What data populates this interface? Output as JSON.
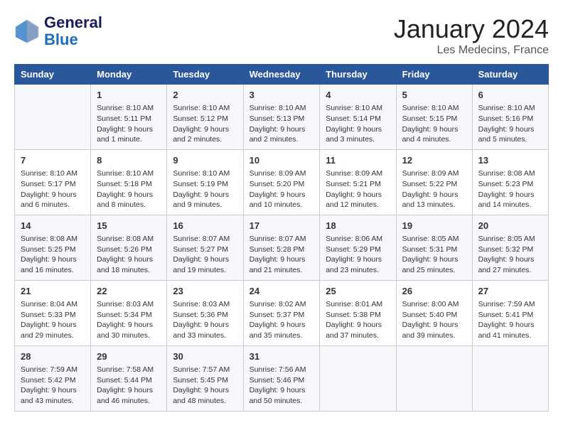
{
  "header": {
    "logo_line1": "General",
    "logo_line2": "Blue",
    "calendar_title": "January 2024",
    "calendar_subtitle": "Les Medecins, France"
  },
  "weekdays": [
    "Sunday",
    "Monday",
    "Tuesday",
    "Wednesday",
    "Thursday",
    "Friday",
    "Saturday"
  ],
  "weeks": [
    [
      {
        "day": "",
        "info": ""
      },
      {
        "day": "1",
        "info": "Sunrise: 8:10 AM\nSunset: 5:11 PM\nDaylight: 9 hours\nand 1 minute."
      },
      {
        "day": "2",
        "info": "Sunrise: 8:10 AM\nSunset: 5:12 PM\nDaylight: 9 hours\nand 2 minutes."
      },
      {
        "day": "3",
        "info": "Sunrise: 8:10 AM\nSunset: 5:13 PM\nDaylight: 9 hours\nand 2 minutes."
      },
      {
        "day": "4",
        "info": "Sunrise: 8:10 AM\nSunset: 5:14 PM\nDaylight: 9 hours\nand 3 minutes."
      },
      {
        "day": "5",
        "info": "Sunrise: 8:10 AM\nSunset: 5:15 PM\nDaylight: 9 hours\nand 4 minutes."
      },
      {
        "day": "6",
        "info": "Sunrise: 8:10 AM\nSunset: 5:16 PM\nDaylight: 9 hours\nand 5 minutes."
      }
    ],
    [
      {
        "day": "7",
        "info": "Sunrise: 8:10 AM\nSunset: 5:17 PM\nDaylight: 9 hours\nand 6 minutes."
      },
      {
        "day": "8",
        "info": "Sunrise: 8:10 AM\nSunset: 5:18 PM\nDaylight: 9 hours\nand 8 minutes."
      },
      {
        "day": "9",
        "info": "Sunrise: 8:10 AM\nSunset: 5:19 PM\nDaylight: 9 hours\nand 9 minutes."
      },
      {
        "day": "10",
        "info": "Sunrise: 8:09 AM\nSunset: 5:20 PM\nDaylight: 9 hours\nand 10 minutes."
      },
      {
        "day": "11",
        "info": "Sunrise: 8:09 AM\nSunset: 5:21 PM\nDaylight: 9 hours\nand 12 minutes."
      },
      {
        "day": "12",
        "info": "Sunrise: 8:09 AM\nSunset: 5:22 PM\nDaylight: 9 hours\nand 13 minutes."
      },
      {
        "day": "13",
        "info": "Sunrise: 8:08 AM\nSunset: 5:23 PM\nDaylight: 9 hours\nand 14 minutes."
      }
    ],
    [
      {
        "day": "14",
        "info": "Sunrise: 8:08 AM\nSunset: 5:25 PM\nDaylight: 9 hours\nand 16 minutes."
      },
      {
        "day": "15",
        "info": "Sunrise: 8:08 AM\nSunset: 5:26 PM\nDaylight: 9 hours\nand 18 minutes."
      },
      {
        "day": "16",
        "info": "Sunrise: 8:07 AM\nSunset: 5:27 PM\nDaylight: 9 hours\nand 19 minutes."
      },
      {
        "day": "17",
        "info": "Sunrise: 8:07 AM\nSunset: 5:28 PM\nDaylight: 9 hours\nand 21 minutes."
      },
      {
        "day": "18",
        "info": "Sunrise: 8:06 AM\nSunset: 5:29 PM\nDaylight: 9 hours\nand 23 minutes."
      },
      {
        "day": "19",
        "info": "Sunrise: 8:05 AM\nSunset: 5:31 PM\nDaylight: 9 hours\nand 25 minutes."
      },
      {
        "day": "20",
        "info": "Sunrise: 8:05 AM\nSunset: 5:32 PM\nDaylight: 9 hours\nand 27 minutes."
      }
    ],
    [
      {
        "day": "21",
        "info": "Sunrise: 8:04 AM\nSunset: 5:33 PM\nDaylight: 9 hours\nand 29 minutes."
      },
      {
        "day": "22",
        "info": "Sunrise: 8:03 AM\nSunset: 5:34 PM\nDaylight: 9 hours\nand 30 minutes."
      },
      {
        "day": "23",
        "info": "Sunrise: 8:03 AM\nSunset: 5:36 PM\nDaylight: 9 hours\nand 33 minutes."
      },
      {
        "day": "24",
        "info": "Sunrise: 8:02 AM\nSunset: 5:37 PM\nDaylight: 9 hours\nand 35 minutes."
      },
      {
        "day": "25",
        "info": "Sunrise: 8:01 AM\nSunset: 5:38 PM\nDaylight: 9 hours\nand 37 minutes."
      },
      {
        "day": "26",
        "info": "Sunrise: 8:00 AM\nSunset: 5:40 PM\nDaylight: 9 hours\nand 39 minutes."
      },
      {
        "day": "27",
        "info": "Sunrise: 7:59 AM\nSunset: 5:41 PM\nDaylight: 9 hours\nand 41 minutes."
      }
    ],
    [
      {
        "day": "28",
        "info": "Sunrise: 7:59 AM\nSunset: 5:42 PM\nDaylight: 9 hours\nand 43 minutes."
      },
      {
        "day": "29",
        "info": "Sunrise: 7:58 AM\nSunset: 5:44 PM\nDaylight: 9 hours\nand 46 minutes."
      },
      {
        "day": "30",
        "info": "Sunrise: 7:57 AM\nSunset: 5:45 PM\nDaylight: 9 hours\nand 48 minutes."
      },
      {
        "day": "31",
        "info": "Sunrise: 7:56 AM\nSunset: 5:46 PM\nDaylight: 9 hours\nand 50 minutes."
      },
      {
        "day": "",
        "info": ""
      },
      {
        "day": "",
        "info": ""
      },
      {
        "day": "",
        "info": ""
      }
    ]
  ]
}
